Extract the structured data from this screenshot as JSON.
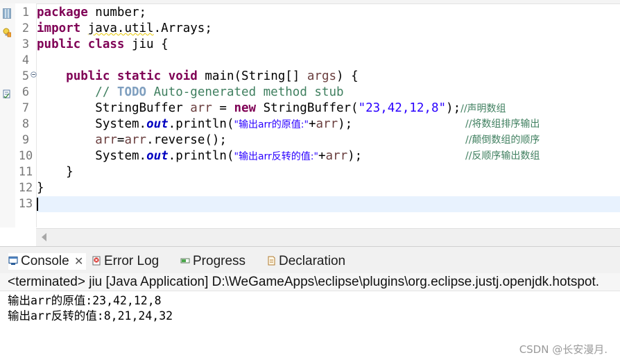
{
  "editor": {
    "lines": [
      {
        "no": "1"
      },
      {
        "no": "2"
      },
      {
        "no": "3"
      },
      {
        "no": "4"
      },
      {
        "no": "5"
      },
      {
        "no": "6"
      },
      {
        "no": "7"
      },
      {
        "no": "8"
      },
      {
        "no": "9"
      },
      {
        "no": "10"
      },
      {
        "no": "11"
      },
      {
        "no": "12"
      },
      {
        "no": "13"
      }
    ],
    "code": {
      "l1_kw": "package",
      "l1_rest": " number;",
      "l2_kw": "import",
      "l2_pkg": "java.util",
      "l2_rest": ".Arrays;",
      "l3_kw1": "public",
      "l3_kw2": "class",
      "l3_rest": " jiu {",
      "l5_kw1": "public",
      "l5_kw2": "static",
      "l5_kw3": "void",
      "l5_mid": " main(String[] ",
      "l5_var": "args",
      "l5_end": ") {",
      "l6_c1": "// ",
      "l6_todo": "TODO",
      "l6_c2": " Auto-generated method stub",
      "l7_a": "StringBuffer ",
      "l7_var": "arr",
      "l7_b": " = ",
      "l7_kw": "new",
      "l7_c": " StringBuffer(",
      "l7_str": "\"23,42,12,8\"",
      "l7_d": ");",
      "l7_cm": "//声明数组",
      "l8_a": "System.",
      "l8_fld": "out",
      "l8_b": ".println(",
      "l8_str": "\"输出arr的原值:\"",
      "l8_c": "+",
      "l8_var": "arr",
      "l8_d": ");",
      "l8_cm": "//将数组排序输出",
      "l9_var1": "arr",
      "l9_a": "=",
      "l9_var2": "arr",
      "l9_b": ".reverse();",
      "l9_cm": "//颠倒数组的顺序",
      "l10_a": "System.",
      "l10_fld": "out",
      "l10_b": ".println(",
      "l10_str": "\"输出arr反转的值:\"",
      "l10_c": "+",
      "l10_var": "arr",
      "l10_d": ");",
      "l10_cm": "//反顺序输出数组",
      "l11": "}",
      "l12": "}"
    }
  },
  "panel": {
    "tabs": [
      {
        "label": "Console",
        "icon": "console-icon",
        "close": "✕"
      },
      {
        "label": "Error Log",
        "icon": "error-log-icon"
      },
      {
        "label": "Progress",
        "icon": "progress-icon"
      },
      {
        "label": "Declaration",
        "icon": "declaration-icon"
      }
    ],
    "status": "<terminated> jiu [Java Application] D:\\WeGameApps\\eclipse\\plugins\\org.eclipse.justj.openjdk.hotspot.",
    "output": [
      "输出arr的原值:23,42,12,8",
      "输出arr反转的值:8,21,24,32"
    ],
    "watermark": "CSDN @长安漫月."
  },
  "colors": {
    "keyword": "#7f0055",
    "comment": "#3f7f5f",
    "string": "#2a00ff",
    "field": "#0000c0",
    "current_line": "#e8f2fe"
  }
}
